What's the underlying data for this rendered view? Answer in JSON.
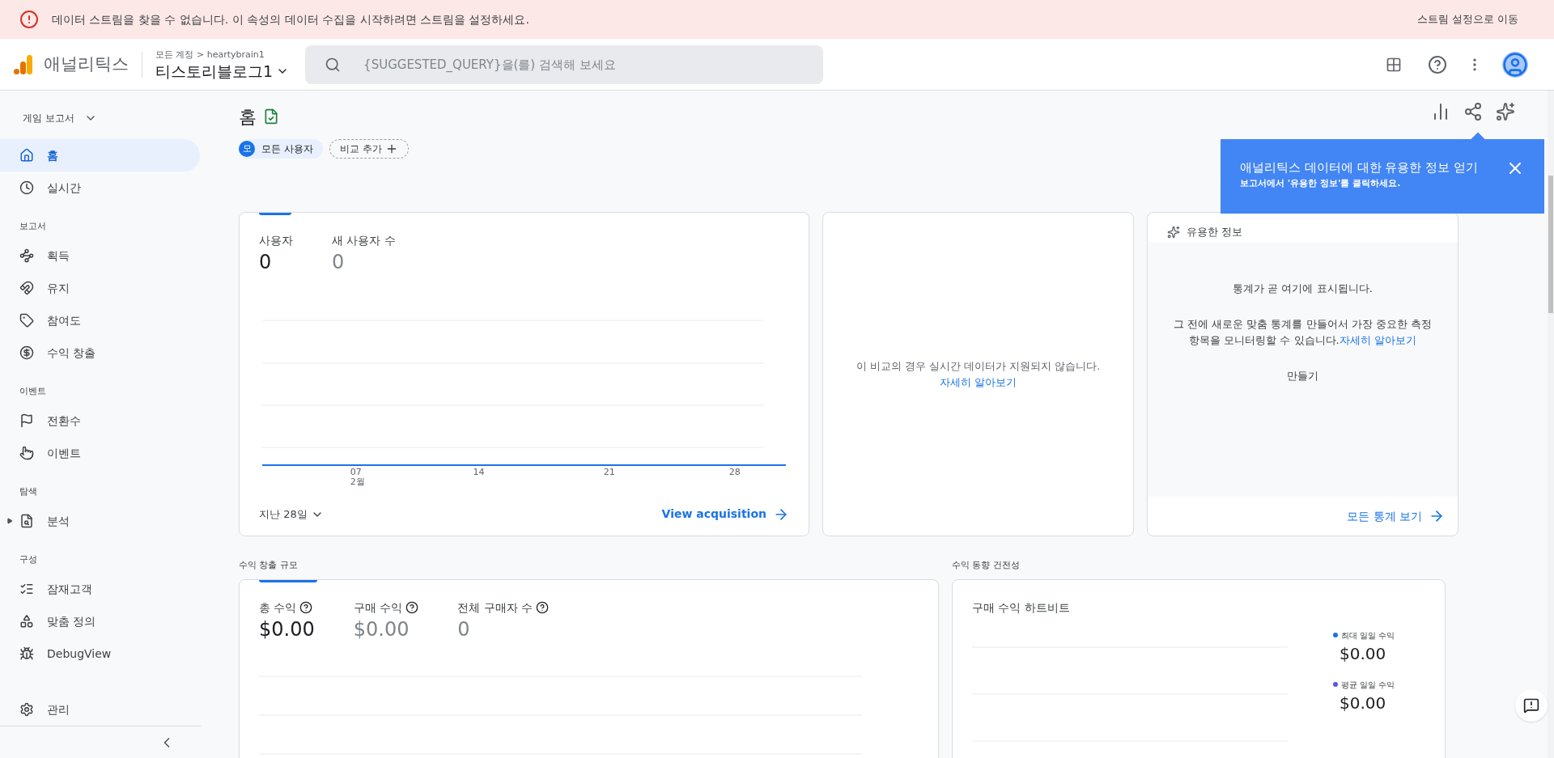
{
  "banner": {
    "message": "데이터 스트림을 찾을 수 없습니다. 이 속성의 데이터 수집을 시작하려면 스트림을 설정하세요.",
    "action": "스트림 설정으로 이동"
  },
  "topbar": {
    "product": "애널리틱스",
    "breadcrumb": "모든 계정 > heartybrain1",
    "property": "티스토리블로그1",
    "search": {
      "placeholder": "{SUGGESTED_QUERY}을(를) 검색해 보세요"
    }
  },
  "sidebar": {
    "collection": "게임 보고서",
    "items": [
      {
        "kind": "item",
        "label": "홈",
        "selected": true
      },
      {
        "kind": "item",
        "label": "실시간",
        "selected": false
      },
      {
        "kind": "header",
        "label": "보고서"
      },
      {
        "kind": "item",
        "label": "획득",
        "selected": false
      },
      {
        "kind": "item",
        "label": "유지",
        "selected": false
      },
      {
        "kind": "item",
        "label": "참여도",
        "selected": false
      },
      {
        "kind": "item",
        "label": "수익 창출",
        "selected": false
      },
      {
        "kind": "header",
        "label": "이벤트"
      },
      {
        "kind": "item",
        "label": "전환수",
        "selected": false
      },
      {
        "kind": "item",
        "label": "이벤트",
        "selected": false
      },
      {
        "kind": "header",
        "label": "탐색"
      },
      {
        "kind": "item",
        "label": "분석",
        "selected": false,
        "expandable": true
      },
      {
        "kind": "header",
        "label": "구성"
      },
      {
        "kind": "item",
        "label": "잠재고객",
        "selected": false
      },
      {
        "kind": "item",
        "label": "맞춤 정의",
        "selected": false
      },
      {
        "kind": "item",
        "label": "DebugView",
        "selected": false
      }
    ],
    "admin": "관리"
  },
  "page": {
    "title": "홈",
    "segment": {
      "badge": "모",
      "label": "모든 사용자"
    },
    "add_comparison": "비교 추가"
  },
  "popover": {
    "title": "애널리틱스 데이터에 대한 유용한 정보 얻기",
    "subtitle": "보고서에서 '유용한 정보'를 클릭하세요."
  },
  "users_card": {
    "metrics": [
      {
        "label": "사용자",
        "value": "0",
        "selected": true
      },
      {
        "label": "새 사용자 수",
        "value": "0",
        "selected": false
      }
    ],
    "x_labels": [
      {
        "day": "07",
        "month": "2월"
      },
      {
        "day": "14"
      },
      {
        "day": "21"
      },
      {
        "day": "28"
      }
    ],
    "range": "지난 28일",
    "link": "View acquisition"
  },
  "realtime_card": {
    "message": "이 비교의 경우 실시간 데이터가 지원되지 않습니다.",
    "link": "자세히 알아보기"
  },
  "insights_card": {
    "title": "유용한 정보",
    "heading": "통계가 곧 여기에 표시됩니다.",
    "body": "그 전에 새로운 맞춤 통계를 만들어서 가장 중요한 측정 항목을 모니터링할 수 있습니다.",
    "link": "자세히 알아보기",
    "create": "만들기",
    "footer_link": "모든 통계 보기"
  },
  "revenue_section": {
    "title": "수익 창출 규모",
    "metrics": [
      {
        "label": "총 수익",
        "value": "$0.00",
        "selected": true
      },
      {
        "label": "구매 수익",
        "value": "$0.00",
        "selected": false
      },
      {
        "label": "전체 구매자 수",
        "value": "0",
        "selected": false
      }
    ]
  },
  "health_section": {
    "title": "수익 동향 건전성",
    "card_title": "구매 수익 하트비트",
    "stats": [
      {
        "label": "최대 일일 수익",
        "value": "$0.00",
        "color": "#1a73e8"
      },
      {
        "label": "평균 일일 수익",
        "value": "$0.00",
        "color": "#5c55e6"
      }
    ]
  }
}
